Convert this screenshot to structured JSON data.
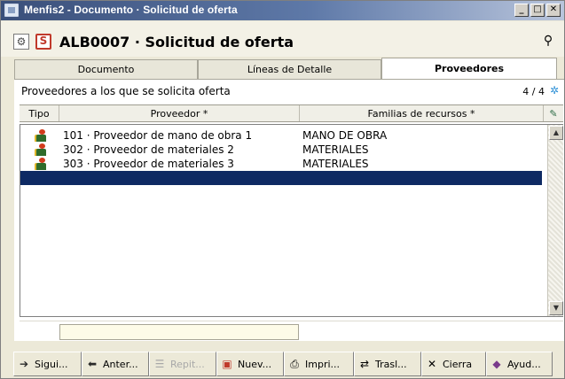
{
  "window": {
    "title": "Menfis2 - Documento · Solicitud de oferta"
  },
  "header": {
    "doc_title": "ALB0007 · Solicitud de oferta",
    "badge": "S"
  },
  "tabs": [
    {
      "label": "Documento"
    },
    {
      "label": "Líneas de Detalle"
    },
    {
      "label": "Proveedores",
      "active": true
    }
  ],
  "panel": {
    "heading": "Proveedores a los que se solicita oferta",
    "count": "4 / 4",
    "columns": {
      "tipo": "Tipo",
      "proveedor": "Proveedor *",
      "familias": "Familias de recursos *"
    },
    "rows": [
      {
        "proveedor": "101 · Proveedor de mano de obra 1",
        "familia": "MANO DE OBRA"
      },
      {
        "proveedor": "302 · Proveedor de materiales 2",
        "familia": "MATERIALES"
      },
      {
        "proveedor": "303 · Proveedor de materiales 3",
        "familia": "MATERIALES"
      }
    ],
    "edit_value": ""
  },
  "toolbar": {
    "siguiente": "Sigui...",
    "anterior": "Anter...",
    "repetir": "Repit...",
    "nuevo": "Nuev...",
    "imprimir": "Impri...",
    "trasladar": "Trasl...",
    "cierra": "Cierra",
    "ayuda": "Ayud..."
  },
  "colors": {
    "selected_row": "#0e2a63",
    "titlebar": "#3a4f7a",
    "edit_bg": "#fdfbe8"
  }
}
